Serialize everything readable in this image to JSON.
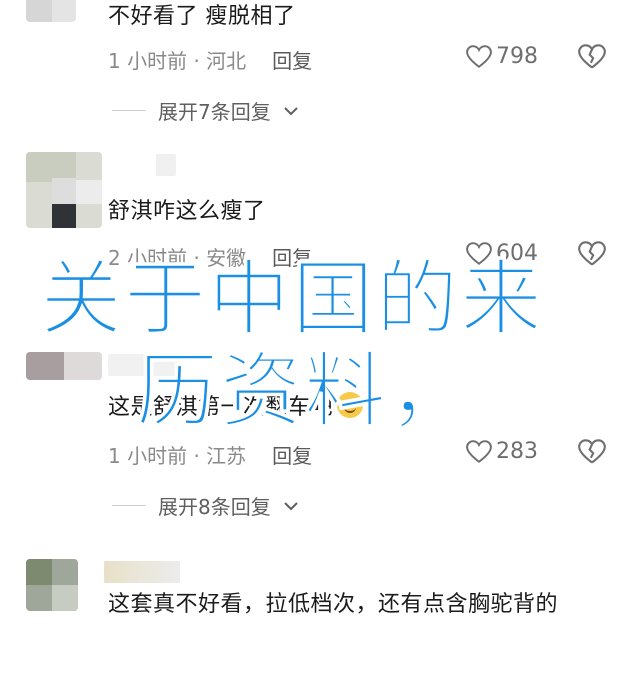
{
  "comments": [
    {
      "text": "不好看了 瘦脱相了",
      "time": "1 小时前 · 河北",
      "reply_label": "回复",
      "likes": "798",
      "expand_label": "展开7条回复"
    },
    {
      "text": "舒淇咋这么瘦了",
      "time": "2 小时前 · 安徽",
      "reply_label": "回复",
      "likes": "604"
    },
    {
      "text": "这是舒淇第一次翻车吧",
      "time": "1 小时前 · 江苏",
      "reply_label": "回复",
      "likes": "283",
      "expand_label": "展开8条回复"
    },
    {
      "text": "这套真不好看，拉低档次，还有点含胸驼背的"
    }
  ],
  "overlay": {
    "line1": "关于中国的来",
    "line2": "历资料，"
  },
  "icons": {
    "like": "heart-icon",
    "dislike": "broken-heart-icon",
    "expand": "chevron-down-icon"
  },
  "colors": {
    "overlay_text": "#1a8fe3",
    "meta_text": "#8a8a8a"
  }
}
